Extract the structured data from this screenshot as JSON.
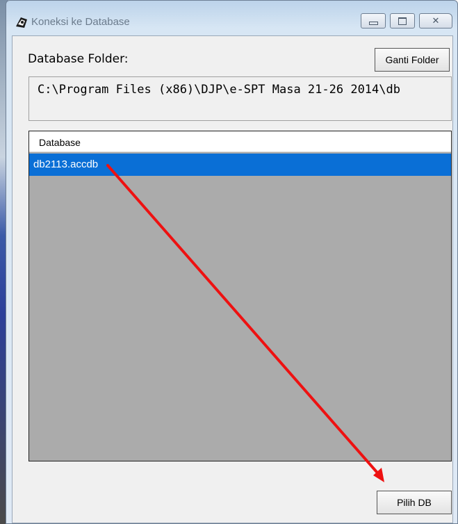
{
  "window": {
    "title": "Koneksi ke Database",
    "icon": "database-app-icon",
    "caption_buttons": [
      "minimize",
      "maximize",
      "close"
    ]
  },
  "folder": {
    "label": "Database Folder:",
    "change_button": "Ganti Folder",
    "path": "C:\\Program Files (x86)\\DJP\\e-SPT Masa 21-26 2014\\db"
  },
  "list": {
    "column_header": "Database",
    "rows": [
      {
        "name": "db2113.accdb",
        "selected": true
      }
    ]
  },
  "actions": {
    "select_button": "Pilih DB"
  },
  "colors": {
    "selection": "#0a6fd6",
    "list_background": "#ababab",
    "annotation_arrow": "#ee1111"
  }
}
